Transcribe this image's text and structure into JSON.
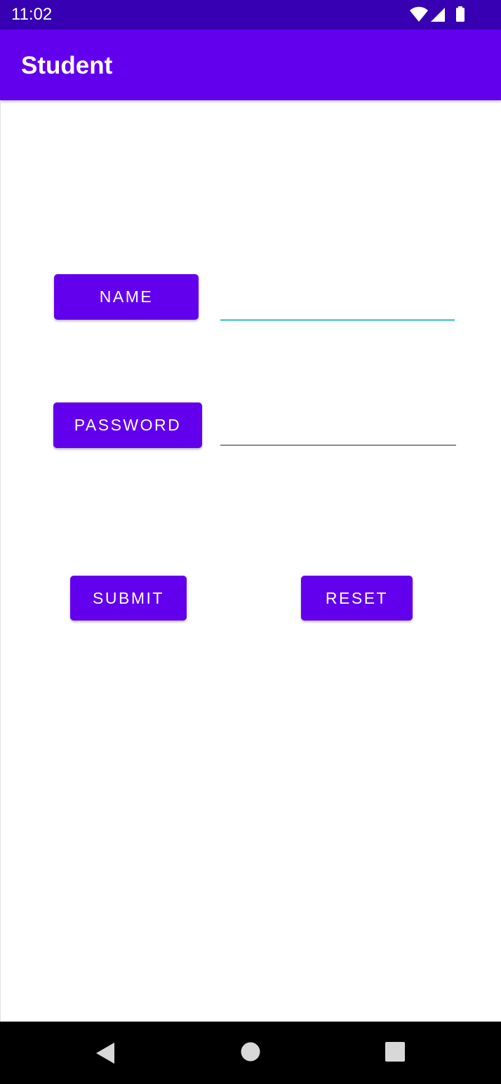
{
  "status_bar": {
    "time": "11:02",
    "icons": [
      "wifi-icon",
      "cellular-signal-icon",
      "battery-icon"
    ],
    "background_color": "#3700B3"
  },
  "app_bar": {
    "title": "Student",
    "background_color": "#6200EE"
  },
  "form": {
    "name_button_label": "NAME",
    "name_input_value": "",
    "name_input_focused": true,
    "password_button_label": "PASSWORD",
    "password_input_value": "",
    "accent_color": "#6200EE",
    "focus_underline_color": "#66D2C6"
  },
  "actions": {
    "submit_label": "SUBMIT",
    "reset_label": "RESET"
  },
  "nav_bar": {
    "buttons": [
      "back-icon",
      "home-icon",
      "recents-icon"
    ]
  }
}
